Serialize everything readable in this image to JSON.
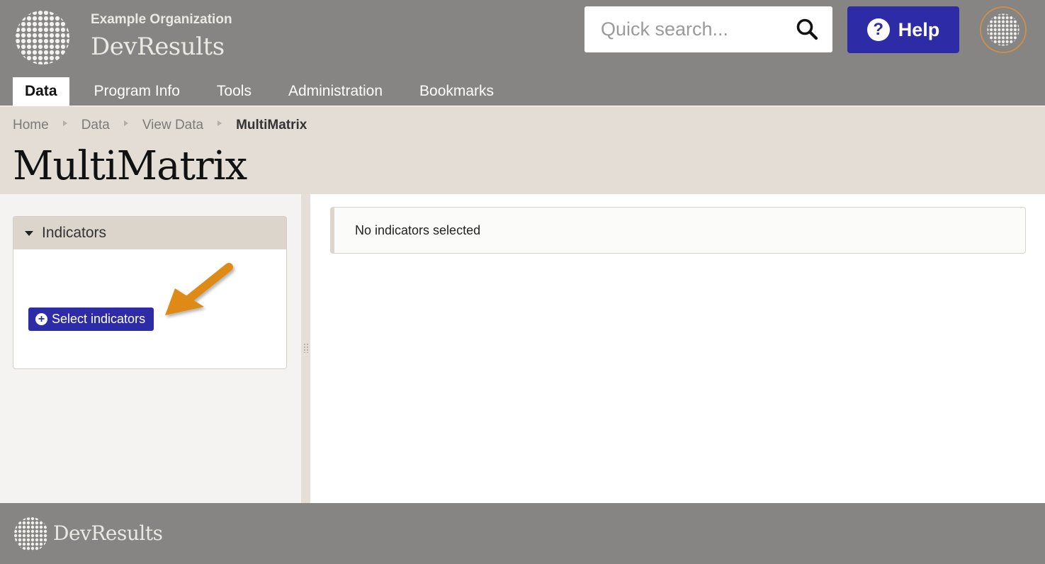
{
  "header": {
    "org_name": "Example Organization",
    "brand_name": "DevResults",
    "search": {
      "placeholder": "Quick search..."
    },
    "help_label": "Help",
    "help_icon_glyph": "?"
  },
  "nav": {
    "tabs": [
      {
        "label": "Data",
        "active": true
      },
      {
        "label": "Program Info"
      },
      {
        "label": "Tools"
      },
      {
        "label": "Administration"
      },
      {
        "label": "Bookmarks"
      }
    ]
  },
  "breadcrumb": [
    "Home",
    "Data",
    "View Data",
    "MultiMatrix"
  ],
  "page_title": "MultiMatrix",
  "left_panel": {
    "card_title": "Indicators",
    "select_button_label": "Select indicators",
    "select_button_icon": "plus-circle"
  },
  "main": {
    "notice_text": "No indicators selected"
  },
  "footer": {
    "brand_name": "DevResults"
  },
  "colors": {
    "header_bg": "#868583",
    "title_band_bg": "#e3ddd6",
    "primary_button": "#2e2ba6",
    "annotation_arrow": "#de8a16"
  }
}
